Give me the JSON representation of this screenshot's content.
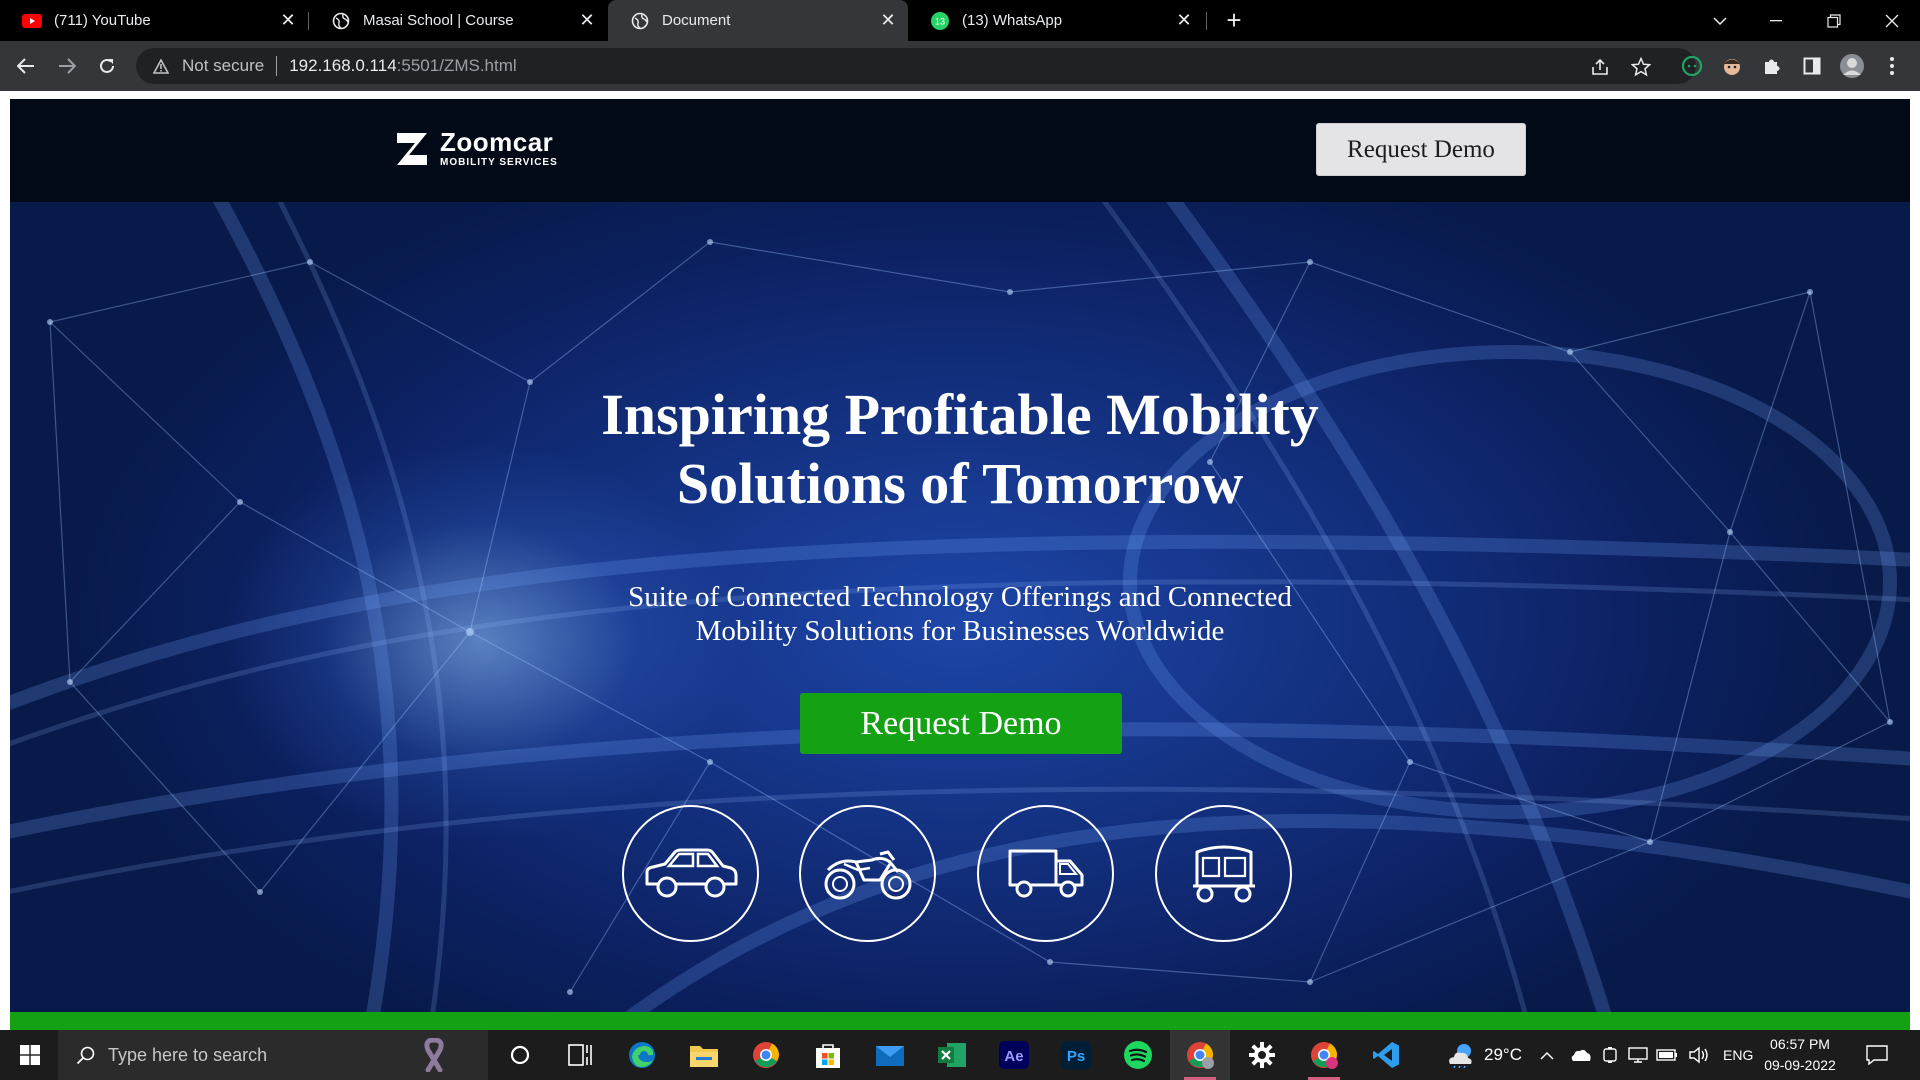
{
  "browser": {
    "tabs": [
      {
        "title": "(711) YouTube",
        "favicon": "youtube-icon",
        "active": false
      },
      {
        "title": "Masai School | Course",
        "favicon": "globe-icon",
        "active": false
      },
      {
        "title": "Document",
        "favicon": "globe-icon",
        "active": true
      },
      {
        "title": "(13) WhatsApp",
        "favicon": "whatsapp-icon",
        "active": false
      }
    ],
    "whatsapp_badge": "13",
    "new_tab_label": "+",
    "security_label": "Not secure",
    "url_host": "192.168.0.114",
    "url_path": ":5501/ZMS.html"
  },
  "site": {
    "logo_name": "Zoomcar",
    "logo_sub": "MOBILITY SERVICES",
    "header_button": "Request Demo",
    "hero_title_line1": "Inspiring Profitable Mobility",
    "hero_title_line2": "Solutions of Tomorrow",
    "hero_sub_line1": "Suite of Connected Technology Offerings and Connected",
    "hero_sub_line2": "Mobility Solutions for Businesses Worldwide",
    "hero_button": "Request Demo",
    "vehicle_icons": [
      "car-icon",
      "motorbike-icon",
      "van-icon",
      "auto-rickshaw-icon"
    ],
    "accent_green": "#14a114"
  },
  "taskbar": {
    "search_placeholder": "Type here to search",
    "apps": [
      "cortana-icon",
      "task-view-icon",
      "edge-icon",
      "file-explorer-icon",
      "chrome-icon",
      "ms-store-icon",
      "mail-icon",
      "excel-icon",
      "after-effects-icon",
      "photoshop-icon",
      "spotify-icon",
      "chrome-icon",
      "settings-icon",
      "chrome-canary-icon",
      "vscode-icon"
    ],
    "ae_label": "Ae",
    "ps_label": "Ps",
    "weather": "29°C",
    "language": "ENG",
    "time": "06:57 PM",
    "date": "09-09-2022"
  }
}
